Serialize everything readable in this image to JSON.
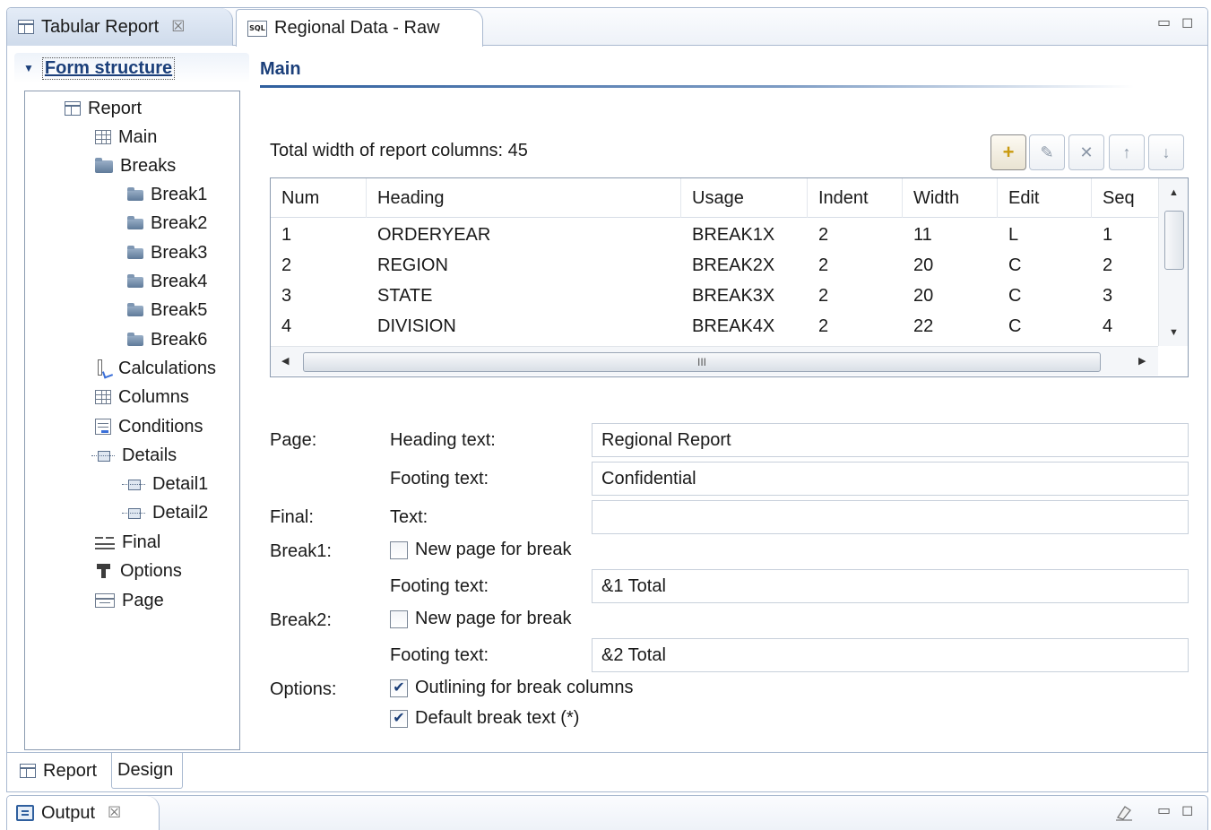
{
  "editor": {
    "tabs": [
      {
        "label": "Tabular Report",
        "icon": "report-icon",
        "close": "☒"
      },
      {
        "label": "Regional Data - Raw",
        "icon": "sql-icon",
        "icon_text": "SQL"
      }
    ],
    "window_controls": {
      "minimize": "▭",
      "maximize": "◻"
    }
  },
  "tree": {
    "title": "Form structure",
    "items": [
      {
        "label": "Report",
        "icon": "report-icon"
      },
      {
        "label": "Main",
        "icon": "grid-icon"
      },
      {
        "label": "Breaks",
        "icon": "folder-icon"
      },
      {
        "label": "Break1",
        "icon": "folder-icon"
      },
      {
        "label": "Break2",
        "icon": "folder-icon"
      },
      {
        "label": "Break3",
        "icon": "folder-icon"
      },
      {
        "label": "Break4",
        "icon": "folder-icon"
      },
      {
        "label": "Break5",
        "icon": "folder-icon"
      },
      {
        "label": "Break6",
        "icon": "folder-icon"
      },
      {
        "label": "Calculations",
        "icon": "calculator-icon"
      },
      {
        "label": "Columns",
        "icon": "grid-icon"
      },
      {
        "label": "Conditions",
        "icon": "conditions-icon"
      },
      {
        "label": "Details",
        "icon": "detail-icon"
      },
      {
        "label": "Detail1",
        "icon": "detail-icon"
      },
      {
        "label": "Detail2",
        "icon": "detail-icon"
      },
      {
        "label": "Final",
        "icon": "final-icon"
      },
      {
        "label": "Options",
        "icon": "options-icon"
      },
      {
        "label": "Page",
        "icon": "page-icon"
      }
    ]
  },
  "main": {
    "title": "Main",
    "total_width_label": "Total width of report columns: 45",
    "toolbar": {
      "add": "+",
      "edit": "✎",
      "delete": "✕",
      "move_up": "↑",
      "move_down": "↓"
    },
    "table": {
      "headers": [
        "Num",
        "Heading",
        "Usage",
        "Indent",
        "Width",
        "Edit",
        "Seq"
      ],
      "rows": [
        [
          "1",
          "ORDERYEAR",
          "BREAK1X",
          "2",
          "11",
          "L",
          "1"
        ],
        [
          "2",
          "REGION",
          "BREAK2X",
          "2",
          "20",
          "C",
          "2"
        ],
        [
          "3",
          "STATE",
          "BREAK3X",
          "2",
          "20",
          "C",
          "3"
        ],
        [
          "4",
          "DIVISION",
          "BREAK4X",
          "2",
          "22",
          "C",
          "4"
        ]
      ],
      "hscroll_grip": "III"
    },
    "form": {
      "page_label": "Page:",
      "heading_text_label": "Heading text:",
      "heading_text_value": "Regional Report",
      "page_footing_label": "Footing text:",
      "page_footing_value": "Confidential",
      "final_label": "Final:",
      "final_text_label": "Text:",
      "final_text_value": "",
      "break1_label": "Break1:",
      "break1_newpage_label": "New page for break",
      "break1_newpage_checked": false,
      "break1_footing_label": "Footing text:",
      "break1_footing_value": "&1 Total",
      "break2_label": "Break2:",
      "break2_newpage_label": "New page for break",
      "break2_newpage_checked": false,
      "break2_footing_label": "Footing text:",
      "break2_footing_value": "&2 Total",
      "options_label": "Options:",
      "outlining_label": "Outlining for break columns",
      "outlining_checked": true,
      "default_break_label": "Default break text (*)",
      "default_break_checked": true
    }
  },
  "bottom_tabs": [
    {
      "label": "Report",
      "icon": "report-icon"
    },
    {
      "label": "Design"
    }
  ],
  "output": {
    "label": "Output",
    "close": "☒",
    "clear_icon": "eraser-icon"
  }
}
